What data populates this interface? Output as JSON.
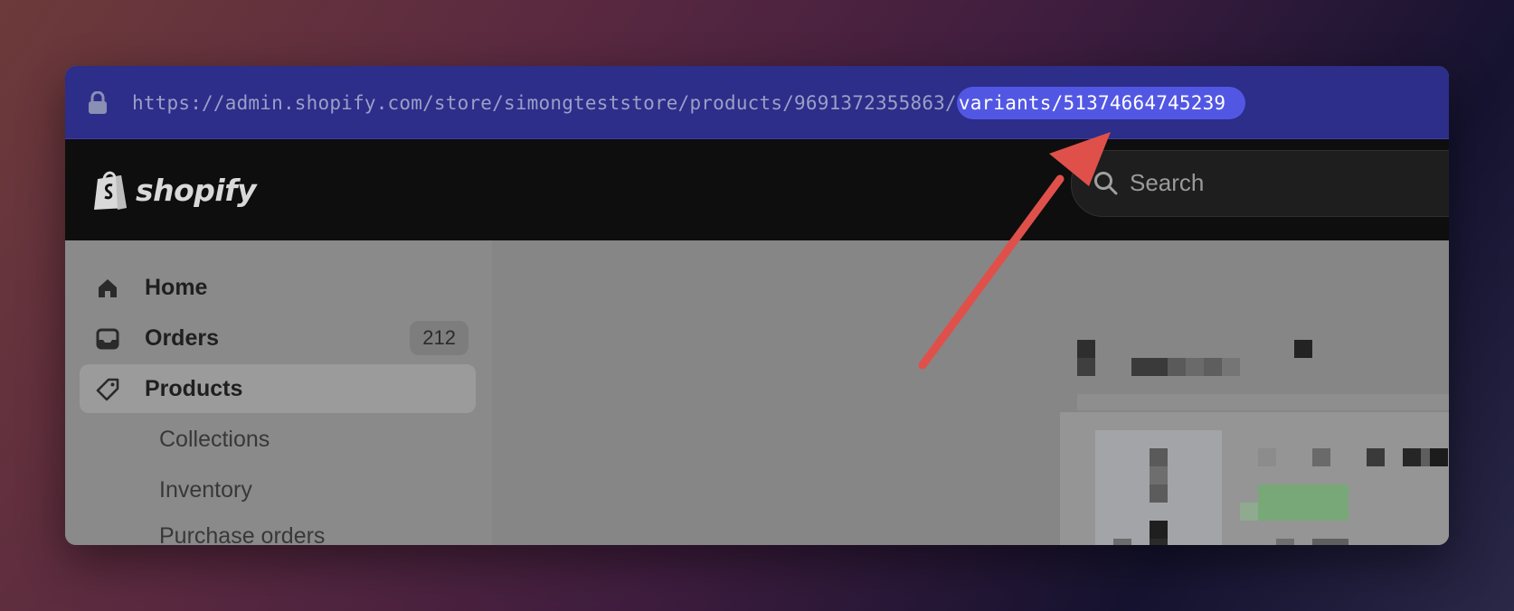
{
  "browser": {
    "url_base": "https://admin.shopify.com/store/simongteststore/products/9691372355863/",
    "url_highlight": "variants/51374664745239"
  },
  "header": {
    "logo_text": "shopify",
    "search_placeholder": "Search"
  },
  "sidebar": {
    "items": [
      {
        "label": "Home",
        "icon": "home-icon"
      },
      {
        "label": "Orders",
        "icon": "inbox-icon",
        "badge": "212"
      },
      {
        "label": "Products",
        "icon": "tag-icon",
        "active": true
      }
    ],
    "subitems": [
      {
        "label": "Collections"
      },
      {
        "label": "Inventory"
      },
      {
        "label": "Purchase orders"
      }
    ]
  },
  "colors": {
    "url_bar": "#2d2d8a",
    "url_highlight": "#5257e3",
    "annotation_arrow": "#e0504a"
  }
}
